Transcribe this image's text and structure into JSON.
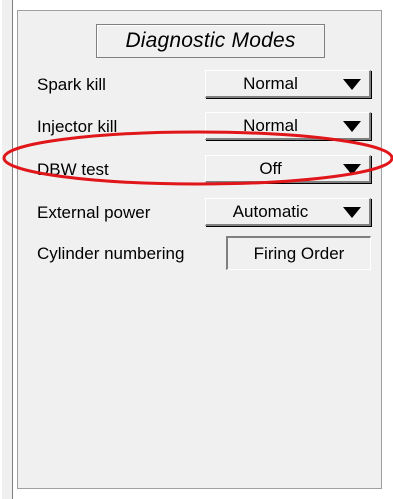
{
  "panel": {
    "title": "Diagnostic Modes"
  },
  "rows": [
    {
      "label": "Spark kill",
      "value": "Normal"
    },
    {
      "label": "Injector kill",
      "value": "Normal"
    },
    {
      "label": "DBW test",
      "value": "Off"
    },
    {
      "label": "External power",
      "value": "Automatic"
    }
  ],
  "cylinder_numbering": {
    "label": "Cylinder numbering",
    "value": "Firing Order"
  },
  "colors": {
    "highlight": "#e0161b",
    "panel_bg": "#f0f0f0"
  },
  "icons": {
    "dropdown": "triangle-down-icon"
  }
}
